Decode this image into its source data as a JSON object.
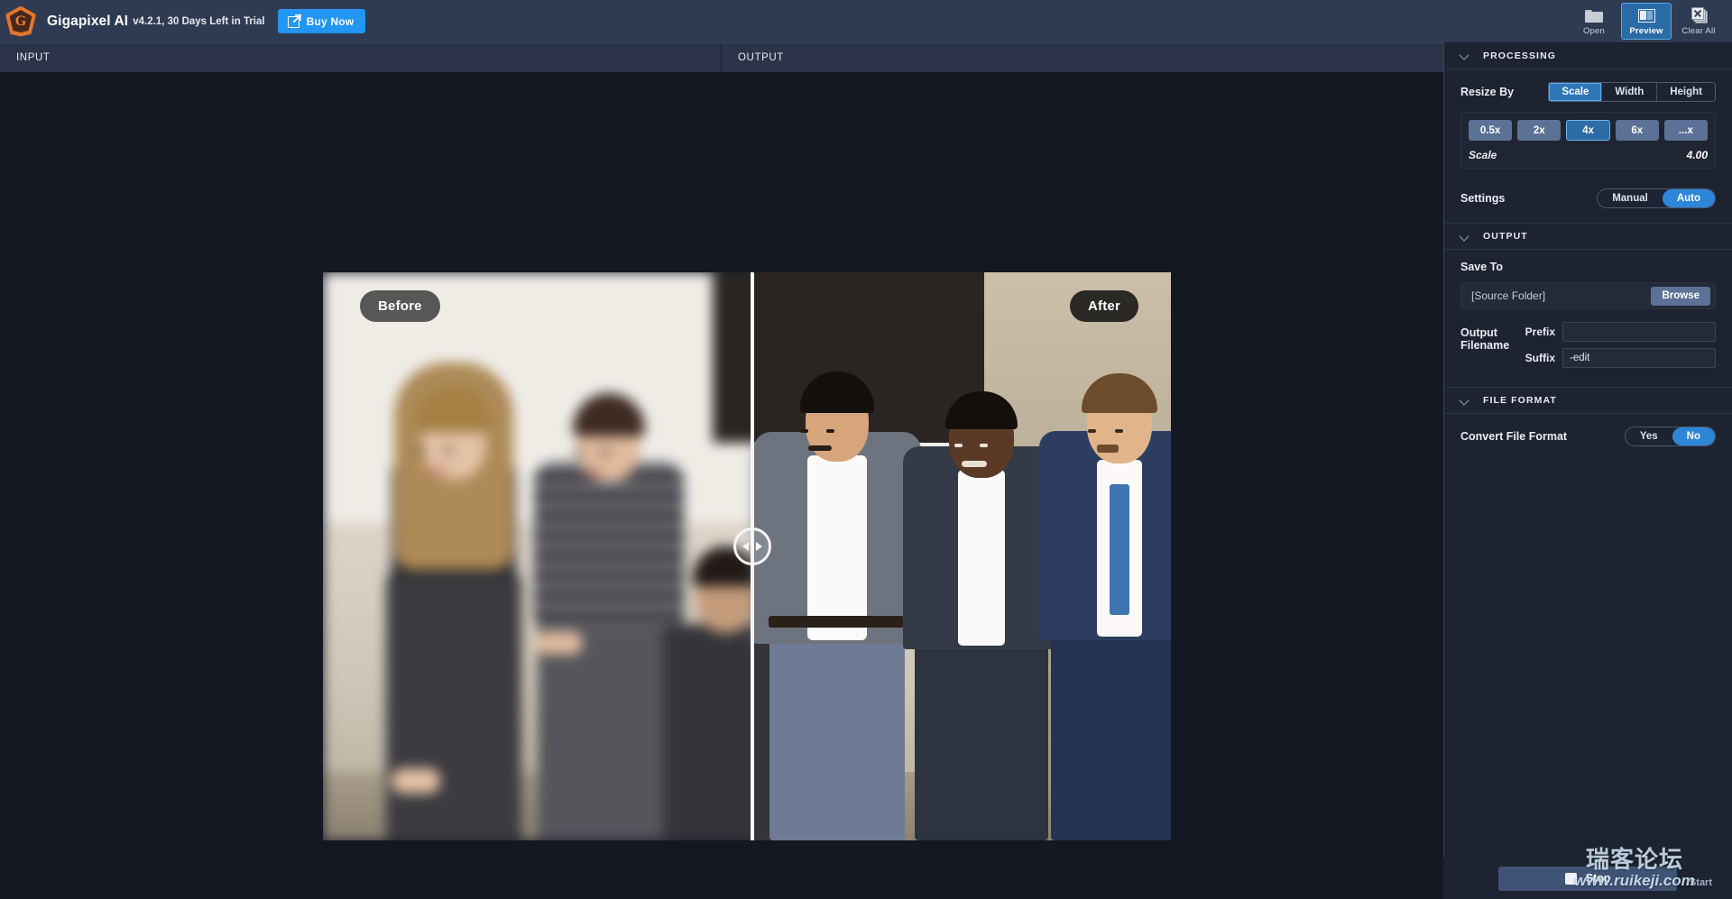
{
  "titlebar": {
    "logo_letter": "G",
    "app_name": "Gigapixel AI",
    "version_text": "v4.2.1, 30 Days Left in Trial",
    "buy_button": "Buy Now",
    "tools": [
      {
        "label": "Open",
        "icon": "folder-icon",
        "active": false
      },
      {
        "label": "Preview",
        "icon": "split-view-icon",
        "active": true
      },
      {
        "label": "Clear All",
        "icon": "clear-all-icon",
        "active": false
      }
    ]
  },
  "tabs": {
    "input": "INPUT",
    "output": "OUTPUT"
  },
  "preview": {
    "before_label": "Before",
    "after_label": "After"
  },
  "panel": {
    "processing": {
      "title": "PROCESSING",
      "resize_by_label": "Resize By",
      "resize_modes": [
        "Scale",
        "Width",
        "Height"
      ],
      "resize_mode_selected": "Scale",
      "scale_presets": [
        "0.5x",
        "2x",
        "4x",
        "6x",
        "...x"
      ],
      "scale_preset_selected": "4x",
      "scale_key": "Scale",
      "scale_value": "4.00",
      "settings_label": "Settings",
      "settings_options": [
        "Manual",
        "Auto"
      ],
      "settings_selected": "Auto"
    },
    "output": {
      "title": "OUTPUT",
      "save_to_label": "Save To",
      "save_to_value": "[Source Folder]",
      "browse_button": "Browse",
      "output_filename_label": "Output Filename",
      "prefix_key": "Prefix",
      "prefix_value": "",
      "suffix_key": "Suffix",
      "suffix_value": "-edit"
    },
    "file_format": {
      "title": "FILE FORMAT",
      "convert_label": "Convert File Format",
      "convert_options": [
        "Yes",
        "No"
      ],
      "convert_selected": "No"
    }
  },
  "action_bar": {
    "stop_button": "Stop",
    "start_button": "Start"
  },
  "watermark": {
    "chinese": "瑞客论坛",
    "url": "www.ruikeji.com"
  },
  "colors": {
    "accent_blue": "#2196f3",
    "active_blue": "#2c6ba5",
    "panel_bg": "#1d2330",
    "titlebar_bg": "#2f3b52",
    "canvas_bg": "#141823",
    "logo_orange": "#e2762a"
  }
}
